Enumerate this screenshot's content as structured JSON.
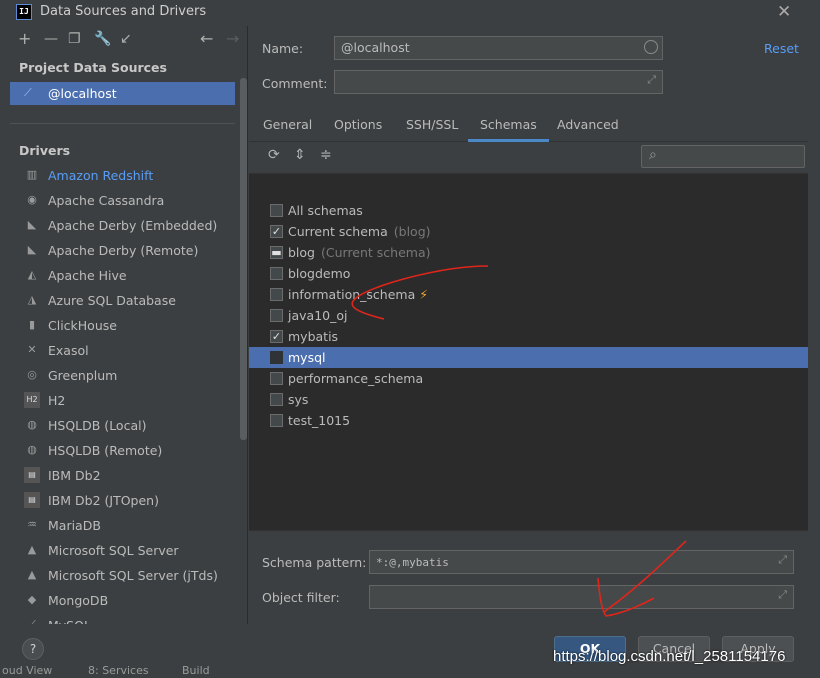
{
  "window": {
    "title": "Data Sources and Drivers",
    "app_icon_text": "IJ"
  },
  "left": {
    "project_title": "Project Data Sources",
    "project_item": "@localhost",
    "drivers_title": "Drivers",
    "drivers": [
      {
        "label": "Amazon Redshift",
        "icon": "redshift-icon"
      },
      {
        "label": "Apache Cassandra",
        "icon": "cassandra-icon"
      },
      {
        "label": "Apache Derby (Embedded)",
        "icon": "derby-icon"
      },
      {
        "label": "Apache Derby (Remote)",
        "icon": "derby-icon"
      },
      {
        "label": "Apache Hive",
        "icon": "hive-icon"
      },
      {
        "label": "Azure SQL Database",
        "icon": "azure-icon"
      },
      {
        "label": "ClickHouse",
        "icon": "clickhouse-icon"
      },
      {
        "label": "Exasol",
        "icon": "exasol-icon"
      },
      {
        "label": "Greenplum",
        "icon": "greenplum-icon"
      },
      {
        "label": "H2",
        "icon": "h2-icon"
      },
      {
        "label": "HSQLDB (Local)",
        "icon": "hsqldb-icon"
      },
      {
        "label": "HSQLDB (Remote)",
        "icon": "hsqldb-icon"
      },
      {
        "label": "IBM Db2",
        "icon": "db2-icon"
      },
      {
        "label": "IBM Db2 (JTOpen)",
        "icon": "db2-icon"
      },
      {
        "label": "MariaDB",
        "icon": "mariadb-icon"
      },
      {
        "label": "Microsoft SQL Server",
        "icon": "mssql-icon"
      },
      {
        "label": "Microsoft SQL Server (jTds)",
        "icon": "mssql-icon"
      },
      {
        "label": "MongoDB",
        "icon": "mongodb-icon"
      },
      {
        "label": "MySQL",
        "icon": "mysql-icon"
      }
    ]
  },
  "form": {
    "name_label": "Name:",
    "name_value": "@localhost",
    "comment_label": "Comment:",
    "comment_value": "",
    "reset_label": "Reset"
  },
  "tabs": [
    "General",
    "Options",
    "SSH/SSL",
    "Schemas",
    "Advanced"
  ],
  "selected_tab": "Schemas",
  "schemas": [
    {
      "name": "All schemas",
      "note": "",
      "checked": false
    },
    {
      "name": "Current schema",
      "note": "(blog)",
      "checked": true
    },
    {
      "name": "blog",
      "note": "(Current schema)",
      "checked": "partial"
    },
    {
      "name": "blogdemo",
      "note": "",
      "checked": false
    },
    {
      "name": "information_schema",
      "note": "",
      "checked": false,
      "bolt": true
    },
    {
      "name": "java10_oj",
      "note": "",
      "checked": false
    },
    {
      "name": "mybatis",
      "note": "",
      "checked": true
    },
    {
      "name": "mysql",
      "note": "",
      "checked": false,
      "selected": true
    },
    {
      "name": "performance_schema",
      "note": "",
      "checked": false
    },
    {
      "name": "sys",
      "note": "",
      "checked": false
    },
    {
      "name": "test_1015",
      "note": "",
      "checked": false
    }
  ],
  "filters": {
    "schema_pattern_label": "Schema pattern:",
    "schema_pattern_value": "*:@,mybatis",
    "object_filter_label": "Object filter:",
    "object_filter_value": ""
  },
  "buttons": {
    "ok": "OK",
    "cancel": "Cancel",
    "apply": "Apply",
    "help": "?"
  },
  "watermark": "https://blog.csdn.net/l_2581154176",
  "ide_bottom": [
    "oud View",
    "8: Services",
    "Build"
  ],
  "colors": {
    "accent": "#4b6eaf",
    "link": "#589df6",
    "annotation": "#e0251b"
  }
}
